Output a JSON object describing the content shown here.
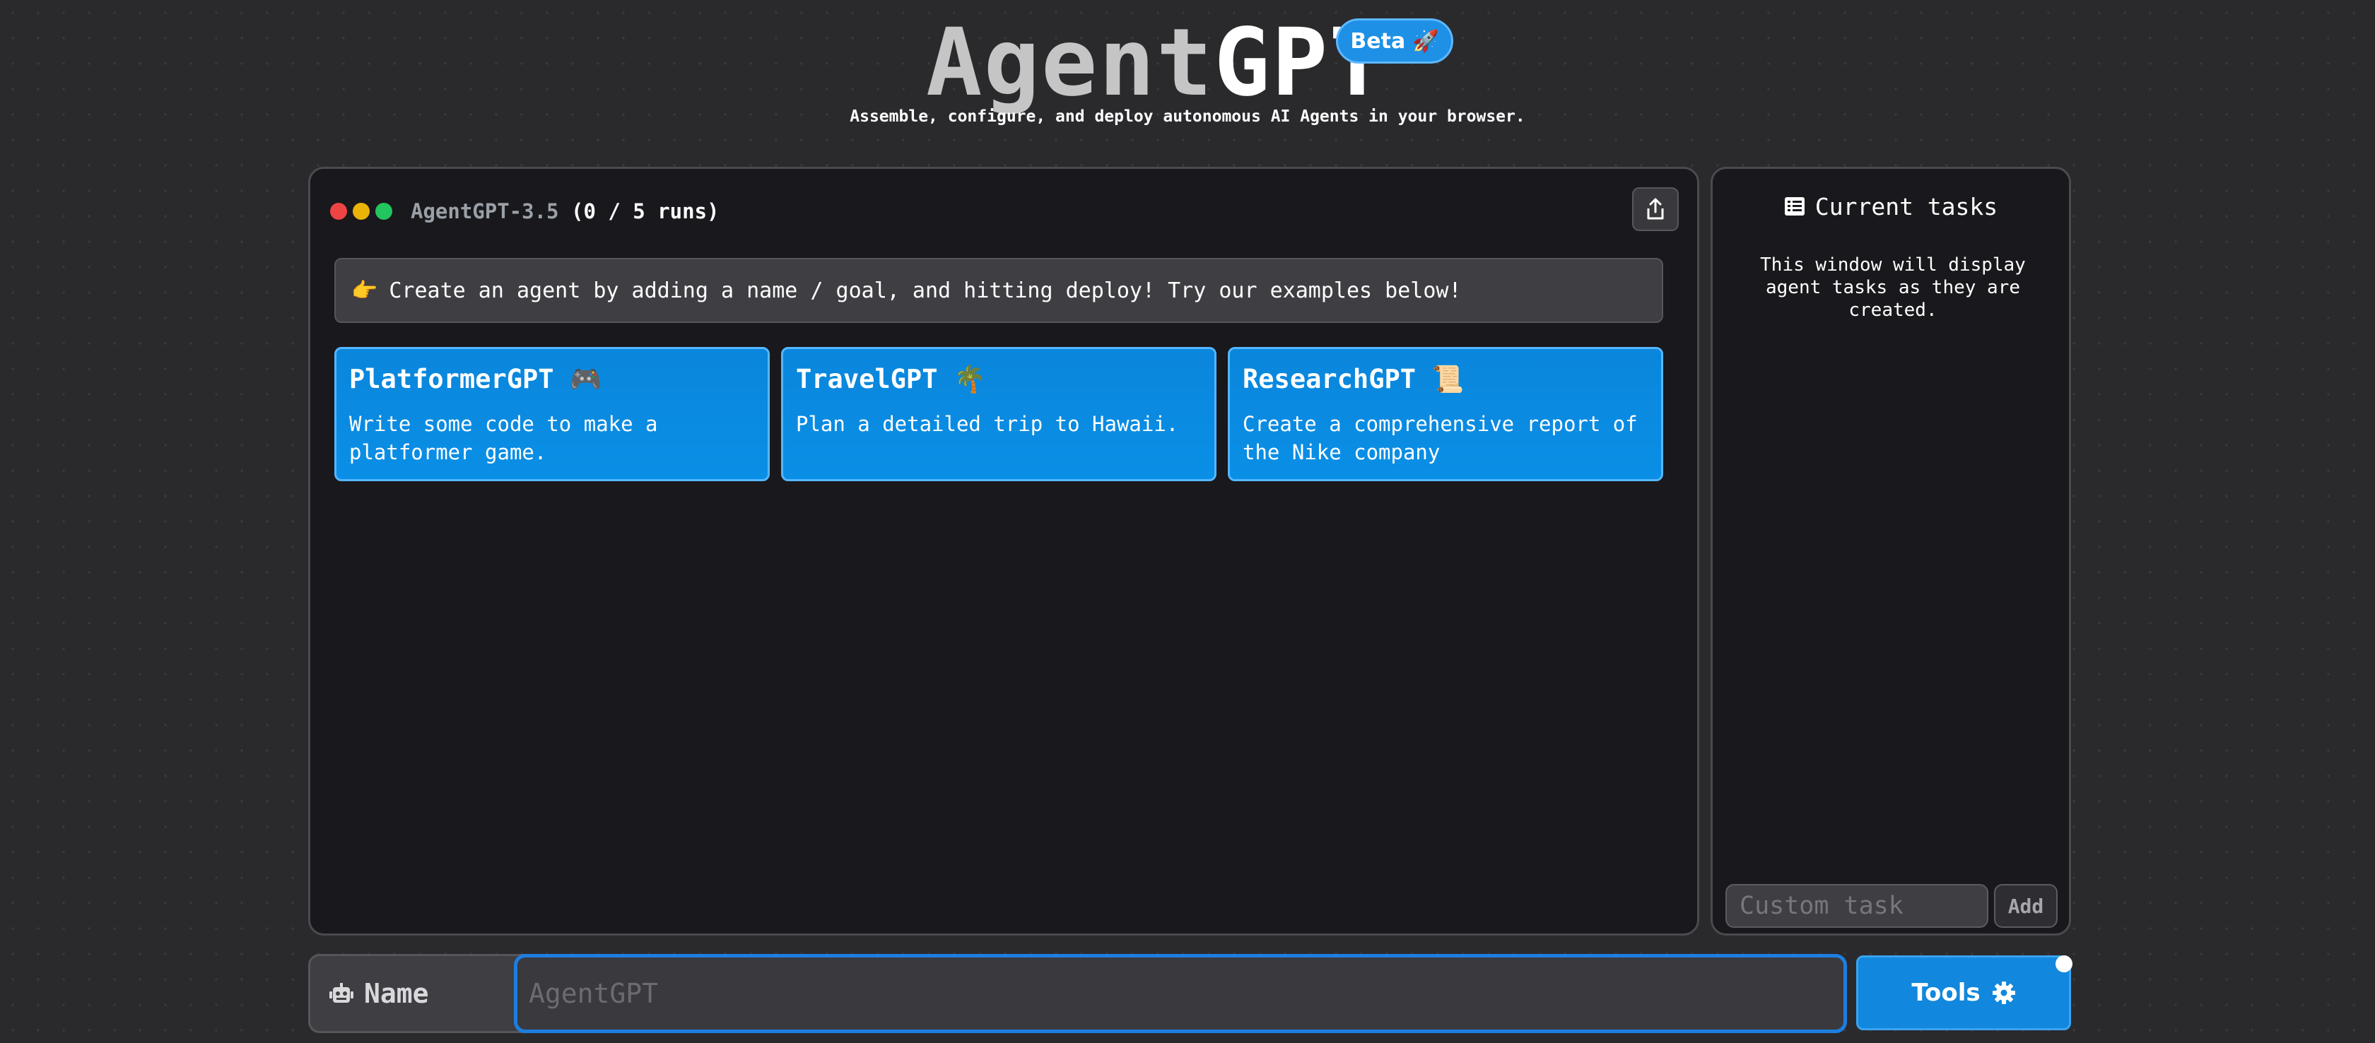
{
  "header": {
    "brand_part1": "Agent",
    "brand_part2": "GPT",
    "beta_label": "Beta",
    "beta_emoji": "🚀",
    "subtitle": "Assemble, configure, and deploy autonomous AI Agents in your browser."
  },
  "window": {
    "model_name": "AgentGPT-3.5",
    "runs": "(0 / 5 runs)",
    "share_icon": "share-icon",
    "banner_emoji": "👉",
    "banner_text": "Create an agent by adding a name / goal, and hitting deploy! Try our examples below!"
  },
  "examples": [
    {
      "title": "PlatformerGPT 🎮",
      "description": "Write some code to make a platformer game."
    },
    {
      "title": "TravelGPT 🌴",
      "description": "Plan a detailed trip to Hawaii."
    },
    {
      "title": "ResearchGPT 📜",
      "description": "Create a comprehensive report of the Nike company"
    }
  ],
  "tasks": {
    "title": "Current tasks",
    "title_icon": "task-list-icon",
    "empty_text": "This window will display agent tasks as they are created.",
    "custom_task_placeholder": "Custom task",
    "add_label": "Add"
  },
  "name_bar": {
    "icon": "robot-icon",
    "label": "Name",
    "placeholder": "AgentGPT"
  },
  "tools": {
    "label": "Tools",
    "icon": "gear-icon"
  },
  "colors": {
    "accent": "#1187dd",
    "background": "#2a2a2d",
    "panel": "#19181c"
  }
}
